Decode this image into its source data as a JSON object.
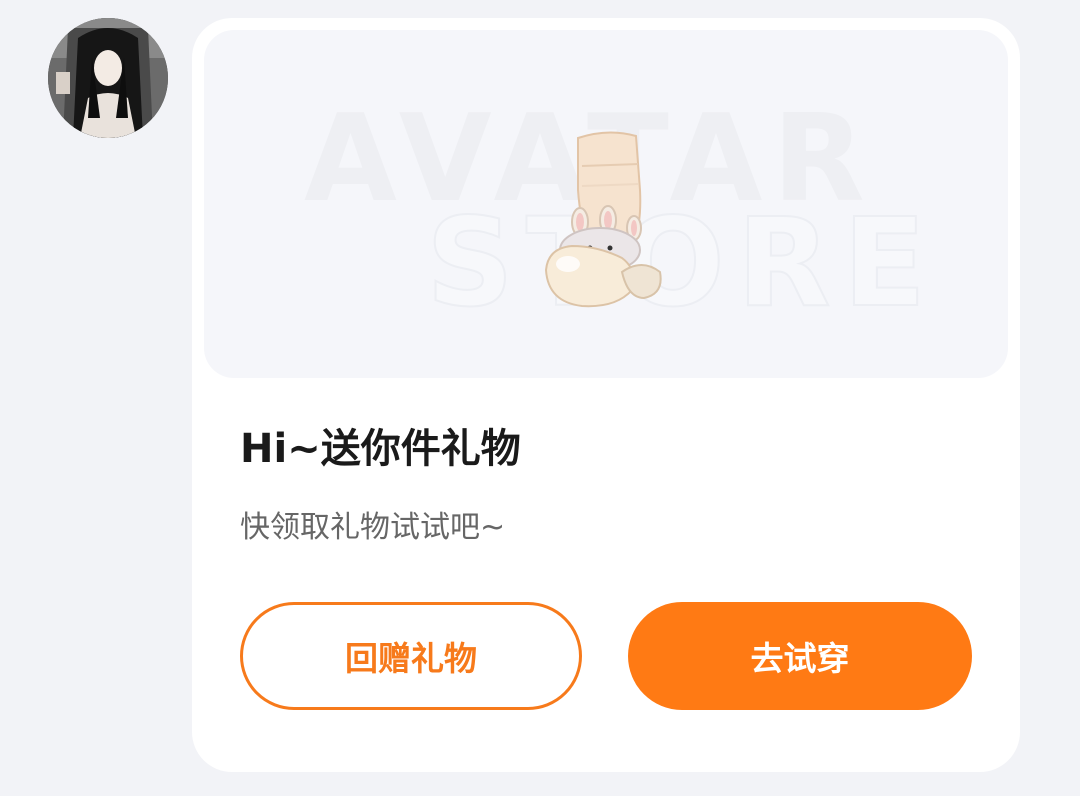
{
  "sender": {
    "avatar_icon": "user-avatar-photo"
  },
  "gift_card": {
    "banner": {
      "watermark_line1": "AVATAR",
      "watermark_line2": "STORE",
      "product_icon": "bunny-slippers-icon"
    },
    "title": "Hi~送你件礼物",
    "subtitle": "快领取礼物试试吧~",
    "buttons": {
      "return_gift": "回赠礼物",
      "try_on": "去试穿"
    }
  },
  "colors": {
    "accent": "#ff7a14",
    "background": "#f2f3f7",
    "card": "#ffffff"
  }
}
